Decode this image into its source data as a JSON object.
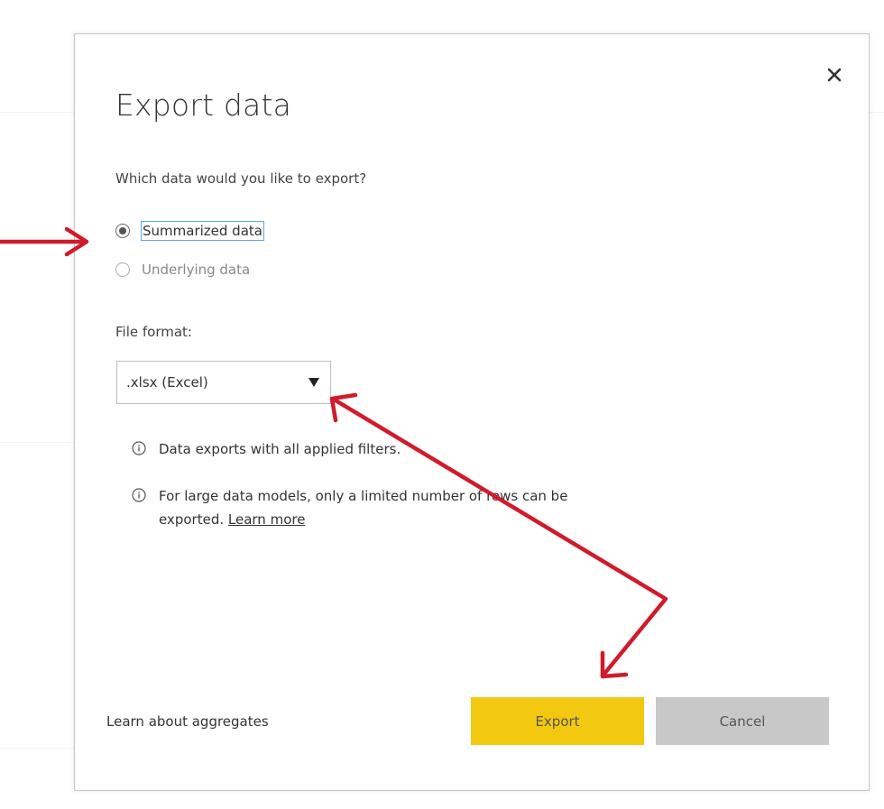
{
  "dialog": {
    "title": "Export data",
    "question": "Which data would you like to export?",
    "options": [
      {
        "label": "Summarized data",
        "selected": true
      },
      {
        "label": "Underlying data",
        "selected": false
      }
    ],
    "file_format_label": "File format:",
    "file_format_value": ".xlsx (Excel)",
    "info": [
      {
        "text": "Data exports with all applied filters."
      },
      {
        "text_line1": "For large data models, only a limited number of rows can be",
        "text_line2": "exported.",
        "link": "Learn more"
      }
    ],
    "aggregates_link": "Learn about aggregates",
    "export_label": "Export",
    "cancel_label": "Cancel",
    "icons": {
      "close": "close-icon",
      "dropdown": "caret-down-icon",
      "info": "info-icon"
    }
  },
  "colors": {
    "export_button": "#f2c811",
    "cancel_button": "#c8c8c8",
    "annotation_arrow": "#d11a2a",
    "focus_outline": "#5aa9e6"
  }
}
